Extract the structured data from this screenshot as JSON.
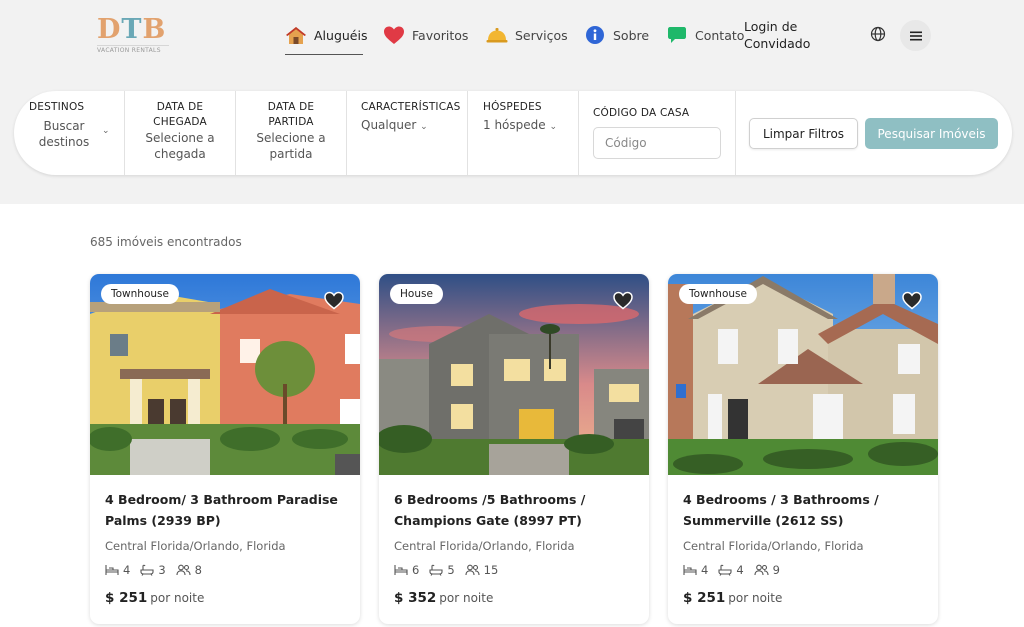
{
  "logo": {
    "text_1": "D",
    "text_2": "T",
    "text_3": "B",
    "subtitle": "VACATION RENTALS"
  },
  "nav": [
    {
      "label": "Aluguéis",
      "icon": "house-icon",
      "active": true
    },
    {
      "label": "Favoritos",
      "icon": "heart-icon"
    },
    {
      "label": "Serviços",
      "icon": "service-bell-icon"
    },
    {
      "label": "Sobre",
      "icon": "info-icon"
    },
    {
      "label": "Contato",
      "icon": "chat-icon"
    }
  ],
  "login": {
    "line1": "Login de",
    "line2": "Convidado"
  },
  "search": {
    "destinations": {
      "label": "DESTINOS",
      "value_1": "Buscar",
      "value_2": "destinos"
    },
    "arrival": {
      "label_1": "DATA DE",
      "label_2": "CHEGADA",
      "value_1": "Selecione a",
      "value_2": "chegada"
    },
    "departure": {
      "label_1": "DATA DE",
      "label_2": "PARTIDA",
      "value_1": "Selecione a",
      "value_2": "partida"
    },
    "features": {
      "label": "CARACTERÍSTICAS",
      "value": "Qualquer"
    },
    "guests": {
      "label": "HÓSPEDES",
      "value": "1 hóspede"
    },
    "code": {
      "label": "CÓDIGO DA CASA",
      "placeholder": "Código"
    },
    "clear_label": "Limpar Filtros",
    "search_label": "Pesquisar Imóveis"
  },
  "results_count": "685 imóveis encontrados",
  "listings": [
    {
      "badge": "Townhouse",
      "title": "4 Bedroom/ 3 Bathroom Paradise Palms (2939 BP)",
      "location": "Central Florida/Orlando, Florida",
      "beds": "4",
      "baths": "3",
      "guests": "8",
      "price": "$ 251",
      "price_unit": "por noite"
    },
    {
      "badge": "House",
      "title": "6 Bedrooms /5 Bathrooms / Champions Gate (8997 PT)",
      "location": "Central Florida/Orlando, Florida",
      "beds": "6",
      "baths": "5",
      "guests": "15",
      "price": "$ 352",
      "price_unit": "por noite"
    },
    {
      "badge": "Townhouse",
      "title": "4 Bedrooms / 3 Bathrooms / Summerville (2612 SS)",
      "location": "Central Florida/Orlando, Florida",
      "beds": "4",
      "baths": "4",
      "guests": "9",
      "price": "$ 251",
      "price_unit": "por noite"
    }
  ],
  "colors": {
    "accent": "#8fbfc3",
    "logo_orange": "#e2a26e",
    "logo_teal": "#6aa8b6",
    "heart_red": "#e03a45"
  }
}
